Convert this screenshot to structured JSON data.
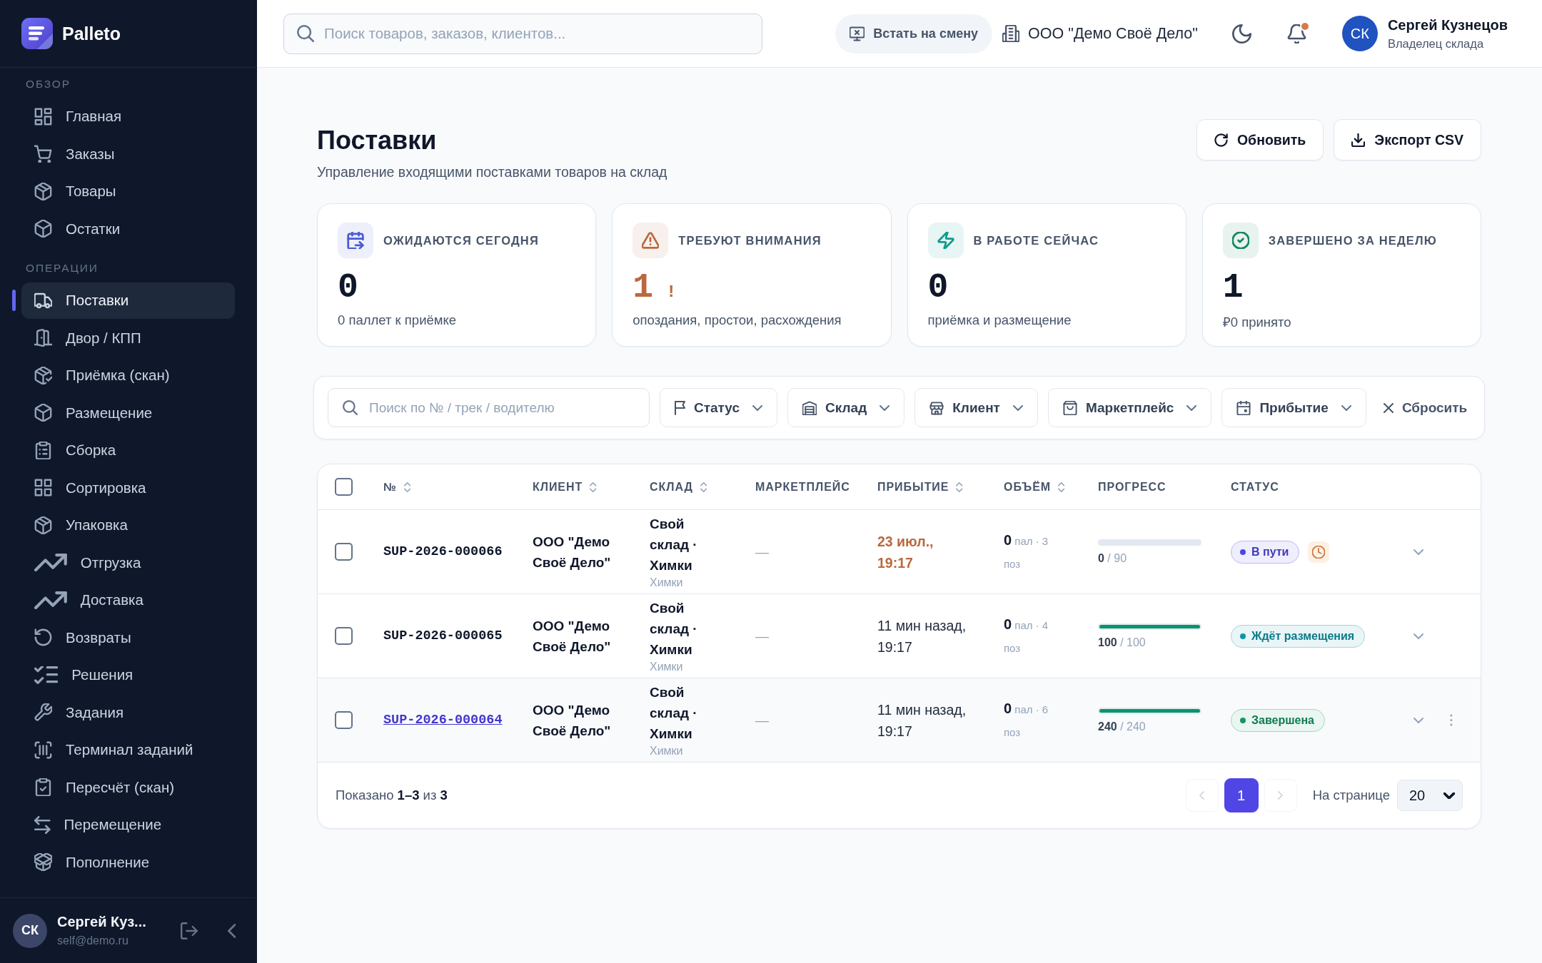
{
  "sidebar": {
    "brand": "Palleto",
    "sections": [
      {
        "title": "ОБЗОР",
        "items": [
          {
            "label": "Главная",
            "selected": false
          },
          {
            "label": "Заказы",
            "selected": false
          },
          {
            "label": "Товары",
            "selected": false
          },
          {
            "label": "Остатки",
            "selected": false
          }
        ]
      },
      {
        "title": "ОПЕРАЦИИ",
        "items": [
          {
            "label": "Поставки",
            "selected": true
          },
          {
            "label": "Двор / КПП",
            "selected": false
          },
          {
            "label": "Приёмка (скан)",
            "selected": false
          },
          {
            "label": "Размещение",
            "selected": false
          },
          {
            "label": "Сборка",
            "selected": false
          },
          {
            "label": "Сортировка",
            "selected": false
          },
          {
            "label": "Упаковка",
            "selected": false
          },
          {
            "label": "Отгрузка",
            "selected": false
          },
          {
            "label": "Доставка",
            "selected": false
          },
          {
            "label": "Возвраты",
            "selected": false
          },
          {
            "label": "Решения",
            "selected": false
          },
          {
            "label": "Задания",
            "selected": false
          },
          {
            "label": "Терминал заданий",
            "selected": false
          },
          {
            "label": "Пересчёт (скан)",
            "selected": false
          },
          {
            "label": "Перемещение",
            "selected": false
          },
          {
            "label": "Пополнение",
            "selected": false
          }
        ]
      }
    ],
    "user": {
      "initials": "СК",
      "name": "Сергей Куз...",
      "email": "self@demo.ru"
    }
  },
  "topbar": {
    "search": {
      "placeholder": "Поиск товаров, заказов, клиентов..."
    },
    "shift_button": "Встать на смену",
    "organization": "ООО \"Демо Своё Дело\"",
    "has_notifications": true,
    "user": {
      "initials": "СК",
      "name": "Сергей Кузнецов",
      "role": "Владелец склада"
    }
  },
  "page": {
    "title": "Поставки",
    "subtitle": "Управление входящими поставками товаров на склад",
    "actions": [
      "Обновить",
      "Экспорт CSV"
    ]
  },
  "stats": [
    {
      "label": "ОЖИДАЮТСЯ СЕГОДНЯ",
      "value": "0",
      "caption": "0 паллет к приёмке",
      "color": "#4a5bd4",
      "alert": false
    },
    {
      "label": "ТРЕБУЮТ ВНИМАНИЯ",
      "value": "1",
      "value_mark": "!",
      "caption": "опоздания, простои, расхождения",
      "color": "#b8693f",
      "alert": true
    },
    {
      "label": "В РАБОТЕ СЕЙЧАС",
      "value": "0",
      "caption": "приёмка и размещение",
      "color": "#0f9c8c",
      "alert": false
    },
    {
      "label": "ЗАВЕРШЕНО ЗА НЕДЕЛЮ",
      "value": "1",
      "caption": "₽0 принято",
      "color": "#17875f",
      "alert": false
    }
  ],
  "filters": {
    "search": {
      "placeholder": "Поиск по № / трек / водителю"
    },
    "dropdowns": [
      "Статус",
      "Склад",
      "Клиент",
      "Маркетплейс",
      "Прибытие"
    ],
    "reset": "Сбросить"
  },
  "table": {
    "select_all": {
      "checked": false
    },
    "columns": [
      {
        "label": "№",
        "sortable": true
      },
      {
        "label": "КЛИЕНТ",
        "sortable": true
      },
      {
        "label": "СКЛАД",
        "sortable": true
      },
      {
        "label": "МАРКЕТПЛЕЙС",
        "sortable": false
      },
      {
        "label": "ПРИБЫТИЕ",
        "sortable": true
      },
      {
        "label": "ОБЪЁМ",
        "sortable": true
      },
      {
        "label": "ПРОГРЕСС",
        "sortable": false
      },
      {
        "label": "СТАТУС",
        "sortable": false
      }
    ],
    "rows": [
      {
        "checked": false,
        "highlighted": false,
        "number": "SUP-2026-000066",
        "client": "ООО \"Демо Своё Дело\"",
        "warehouse": "Свой склад · Химки",
        "warehouse_city": "Химки",
        "marketplace": "—",
        "arrival_date": "23 июл.,",
        "arrival_time": "19:17",
        "delayed": true,
        "volume": "**0** пал · 3 поз",
        "level": 0,
        "progress": "**0** / 90",
        "status": {
          "label": "В пути",
          "color": "#4f46e5"
        }
      },
      {
        "checked": false,
        "highlighted": false,
        "number": "SUP-2026-000065",
        "client": "ООО \"Демо Своё Дело\"",
        "warehouse": "Свой склад · Химки",
        "warehouse_city": "Химки",
        "marketplace": "—",
        "arrival_date": "11 мин назад,",
        "arrival_time": "19:17",
        "delayed": false,
        "volume": "**0** пал · 4 поз",
        "level": 1,
        "progress": "**100** / 100",
        "status": {
          "label": "Ждёт размещения",
          "color": "#0e95a5"
        }
      },
      {
        "checked": false,
        "highlighted": true,
        "number": "SUP-2026-000064",
        "client": "ООО \"Демо Своё Дело\"",
        "warehouse": "Свой склад · Химки",
        "warehouse_city": "Химки",
        "marketplace": "—",
        "arrival_date": "11 мин назад,",
        "arrival_time": "19:17",
        "delayed": false,
        "volume": "**0** пал · 6 поз",
        "level": 1,
        "progress": "**240** / 240",
        "status": {
          "label": "Завершена",
          "color": "#129667"
        }
      }
    ],
    "footer": {
      "summary": "Показано **1–3** из **3**",
      "prev_disabled": true,
      "next_disabled": true,
      "pages": [
        {
          "label": "1",
          "selected": true
        }
      ],
      "per_page_label": "На странице",
      "per_page": "20"
    }
  }
}
